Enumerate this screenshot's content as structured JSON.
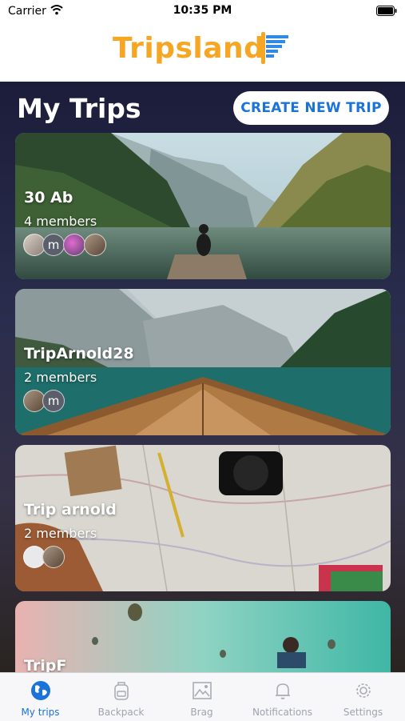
{
  "status_bar": {
    "carrier": "Carrier",
    "time": "10:35 PM"
  },
  "app": {
    "logo_text": "Tripsland",
    "brand_color": "#f5a623",
    "accent_color": "#1a73d9"
  },
  "header": {
    "title": "My Trips",
    "create_button": "CREATE NEW TRIP"
  },
  "trips": [
    {
      "name": "30 Ab",
      "members": "4 members",
      "avatars": [
        "photo",
        "m",
        "photo",
        "photo"
      ]
    },
    {
      "name": "TripArnold28",
      "members": "2 members",
      "avatars": [
        "photo",
        "m"
      ]
    },
    {
      "name": "Trip arnold",
      "members": "2 members",
      "avatars": [
        "blank",
        "photo"
      ]
    },
    {
      "name": "TripF",
      "members": "",
      "avatars": []
    }
  ],
  "tabs": [
    {
      "label": "My trips",
      "icon": "globe-icon",
      "active": true
    },
    {
      "label": "Backpack",
      "icon": "backpack-icon",
      "active": false
    },
    {
      "label": "Brag",
      "icon": "image-icon",
      "active": false
    },
    {
      "label": "Notifications",
      "icon": "bell-icon",
      "active": false
    },
    {
      "label": "Settings",
      "icon": "gear-icon",
      "active": false
    }
  ]
}
